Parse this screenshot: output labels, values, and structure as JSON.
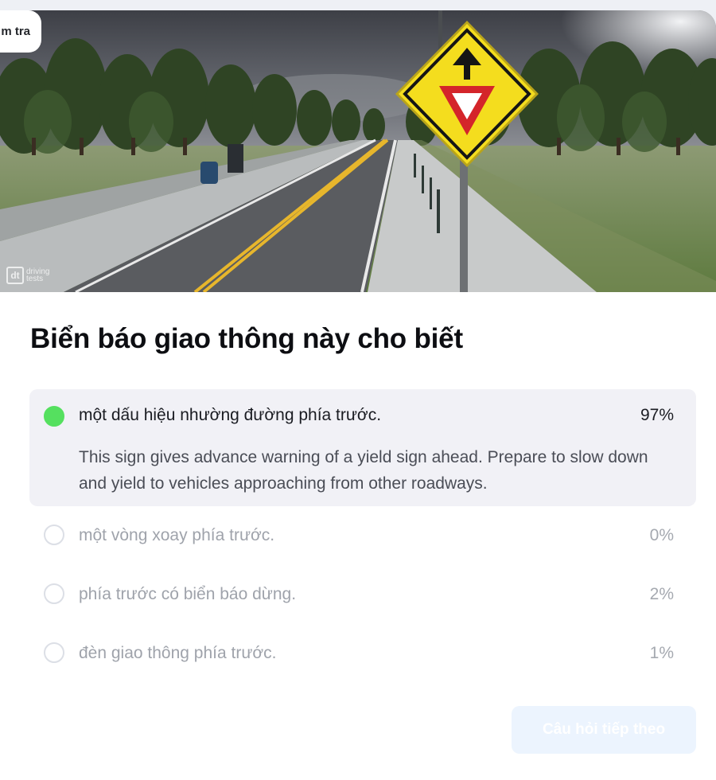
{
  "header": {
    "tag_label": "m tra"
  },
  "scene": {
    "watermark": "driving tests",
    "watermark_logo": "dt"
  },
  "question": {
    "title": "Biển báo giao thông này cho biết"
  },
  "answers": [
    {
      "text": "một dấu hiệu nhường đường phía trước.",
      "percent": "97%",
      "selected": true,
      "explanation": "This sign gives advance warning of a yield sign ahead. Prepare to slow down and yield to vehicles approaching from other roadways."
    },
    {
      "text": "một vòng xoay phía trước.",
      "percent": "0%",
      "selected": false
    },
    {
      "text": "phía trước có biển báo dừng.",
      "percent": "2%",
      "selected": false
    },
    {
      "text": "đèn giao thông phía trước.",
      "percent": "1%",
      "selected": false
    }
  ],
  "actions": {
    "next_label": "Câu hỏi tiếp theo"
  },
  "colors": {
    "correct": "#55e05f",
    "sign_yellow": "#f4dd1e",
    "yield_red": "#d4252a",
    "button_bg": "#ecf4fe"
  }
}
